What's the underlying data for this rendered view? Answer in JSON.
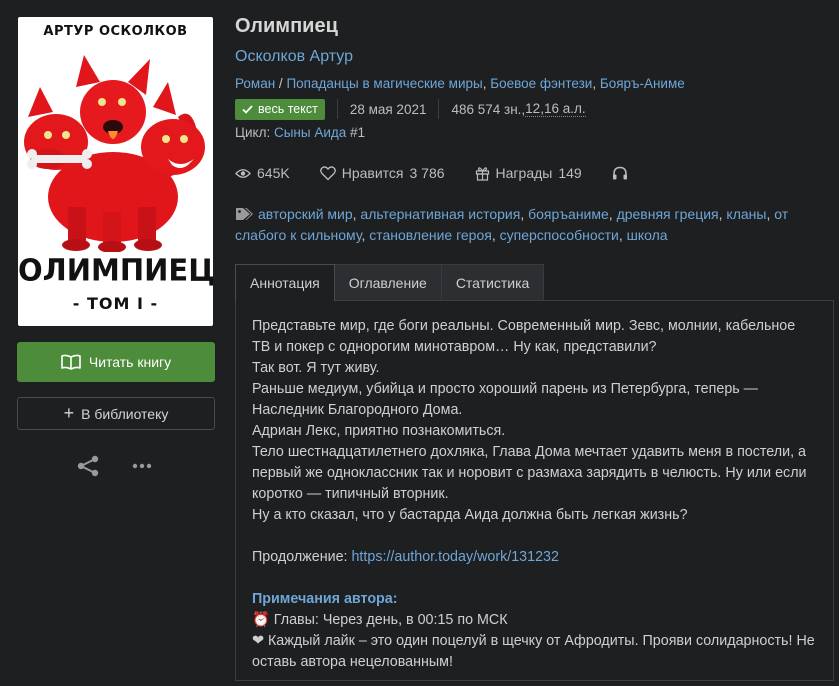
{
  "cover": {
    "author": "АРТУР ОСКОЛКОВ",
    "title": "ОЛИМПИЕЦ",
    "volume": "- ТОМ I -"
  },
  "actions": {
    "read_label": "Читать книгу",
    "library_label": "В библиотеку",
    "read_icon": "open-book-icon",
    "share_icon": "share-icon",
    "more_icon": "ellipsis-icon"
  },
  "book": {
    "title": "Олимпиец",
    "author": "Осколков Артур",
    "genres": {
      "type": "Роман",
      "sep": " / ",
      "items": [
        "Попаданцы в магические миры",
        "Боевое фэнтези",
        "Бояръ-Аниме"
      ]
    },
    "badge": "весь текст",
    "date": "28 мая 2021",
    "size_prefix": "486 574 зн., ",
    "size_al": "12,16 а.л.",
    "cycle_label": "Цикл: ",
    "cycle_name": "Сыны Аида",
    "cycle_number": " #1"
  },
  "stats": {
    "views": "645K",
    "likes_label": "Нравится",
    "likes": "3 786",
    "awards_label": "Награды",
    "awards": "149"
  },
  "tags": [
    "авторский мир",
    "альтернативная история",
    "бояръаниме",
    "древняя греция",
    "кланы",
    "от слабого к сильному",
    "становление героя",
    "суперспособности",
    "школа"
  ],
  "tabs": [
    "Аннотация",
    "Оглавление",
    "Статистика"
  ],
  "annotation": {
    "p1": "Представьте мир, где боги реальны. Современный мир. Зевс, молнии, кабельное ТВ и покер с однорогим минотавром… Ну как, представили?",
    "p2": "Так вот. Я тут живу.",
    "p3": "Раньше медиум, убийца и просто хороший парень из Петербурга, теперь — Наследник Благородного Дома.",
    "p4": "Адриан Лекс, приятно познакомиться.",
    "p5": "Тело шестнадцатилетнего дохляка, Глава Дома мечтает удавить меня в постели, а первый же одноклассник так и норовит с размаха зарядить в челюсть. Ну или если коротко — типичный вторник.",
    "p6": "Ну а кто сказал, что у бастарда Аида должна быть легкая жизнь?",
    "continuation_label": "Продолжение: ",
    "continuation_link": "https://author.today/work/131232",
    "notes_title": "Примечания автора:",
    "note1_icon": "⏰",
    "note1": " Главы: Через день, в 00:15 по МСК",
    "note2_icon": "❤",
    "note2": " Каждый лайк – это один поцелуй в щечку от Афродиты. Прояви солидарность! Не оставь автора нецелованным!"
  },
  "colors": {
    "background": "#1e1f21",
    "link": "#6fa6d6",
    "accent_green": "#4c8c3a",
    "cover_red": "#e0161b"
  }
}
